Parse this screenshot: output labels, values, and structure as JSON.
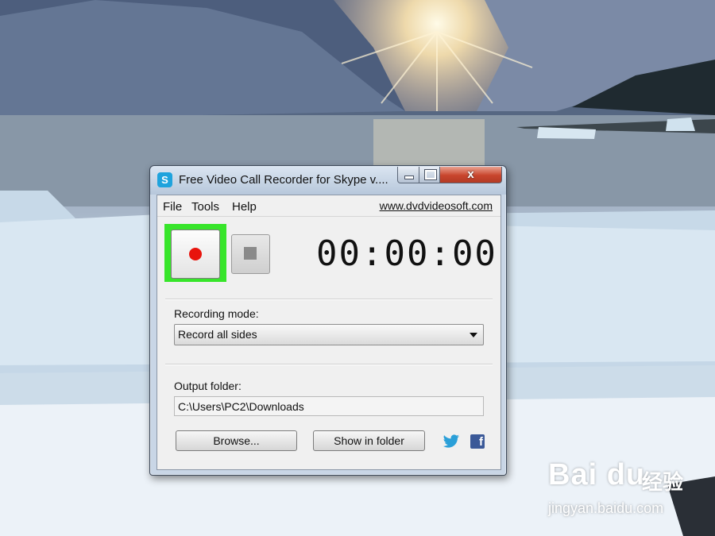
{
  "window": {
    "title": "Free Video Call Recorder for Skype v....",
    "app_icon_letter": "S",
    "close_glyph": "x"
  },
  "menu": {
    "items": [
      "File",
      "Tools",
      "Help"
    ],
    "site_link": "www.dvdvideosoft.com"
  },
  "timer": {
    "value": "00:00:00"
  },
  "recording_mode": {
    "label": "Recording mode:",
    "selected": "Record all sides"
  },
  "output": {
    "label": "Output folder:",
    "path": "C:\\Users\\PC2\\Downloads"
  },
  "buttons": {
    "browse": "Browse...",
    "show_in_folder": "Show in folder"
  },
  "social": {
    "facebook_letter": "f"
  },
  "watermark": {
    "logo": "Bai du",
    "logo_suffix": "经验",
    "url": "jingyan.baidu.com"
  },
  "colors": {
    "highlight": "#37e52a",
    "record_dot": "#e8140d",
    "close_button": "#c8452d"
  }
}
